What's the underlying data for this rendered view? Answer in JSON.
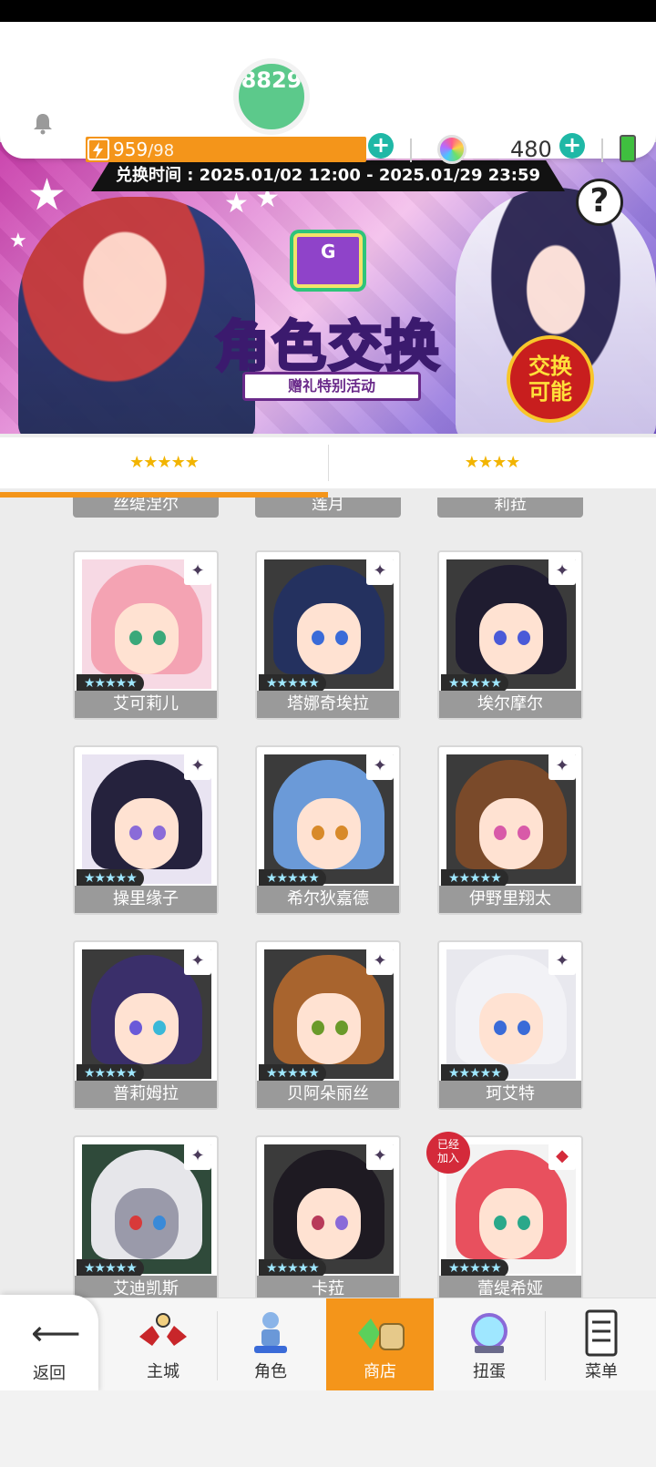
{
  "header": {
    "level_partial": "8829",
    "energy_current": "959",
    "energy_max": "/98",
    "gem_count": "480"
  },
  "banner": {
    "exchange_time": "兑换时间 : 2025.01/02 12:00 - 2025.01/29 23:59",
    "title": "角色交换",
    "subtitle": "赠礼特别活动",
    "badge": "交换可能",
    "help": "?"
  },
  "tabs": [
    {
      "label": "★★★★★",
      "active": true
    },
    {
      "label": "★★★★",
      "active": false
    }
  ],
  "top_partial_names": [
    "丝缇涅尔",
    "莲月",
    "莉菈"
  ],
  "characters": [
    {
      "name": "艾可莉儿",
      "stars": "★★★★★",
      "corner": "✦"
    },
    {
      "name": "塔娜奇埃拉",
      "stars": "★★★★★",
      "corner": "✦"
    },
    {
      "name": "埃尔摩尔",
      "stars": "★★★★★",
      "corner": "✦"
    },
    {
      "name": "操里缘子",
      "stars": "★★★★★",
      "corner": "✦"
    },
    {
      "name": "希尔狄嘉德",
      "stars": "★★★★★",
      "corner": "✦"
    },
    {
      "name": "伊野里翔太",
      "stars": "★★★★★",
      "corner": "✦"
    },
    {
      "name": "普莉姆拉",
      "stars": "★★★★★",
      "corner": "✦"
    },
    {
      "name": "贝阿朵丽丝",
      "stars": "★★★★★",
      "corner": "✦"
    },
    {
      "name": "珂艾特",
      "stars": "★★★★★",
      "corner": "✦"
    },
    {
      "name": "艾迪凯斯",
      "stars": "★★★★★",
      "corner": "✦"
    },
    {
      "name": "卡菈",
      "stars": "★★★★★",
      "corner": "✦"
    },
    {
      "name": "蕾缇希娅",
      "stars": "★★★★★",
      "corner": "◆",
      "joined": "已经加入"
    }
  ],
  "nav": {
    "back": "返回",
    "items": [
      "主城",
      "角色",
      "商店",
      "扭蛋",
      "菜单"
    ],
    "active": "商店"
  },
  "colors": {
    "accent": "#f4951a",
    "plus": "#1fb8a6",
    "name_bg": "#9a9a9a"
  }
}
